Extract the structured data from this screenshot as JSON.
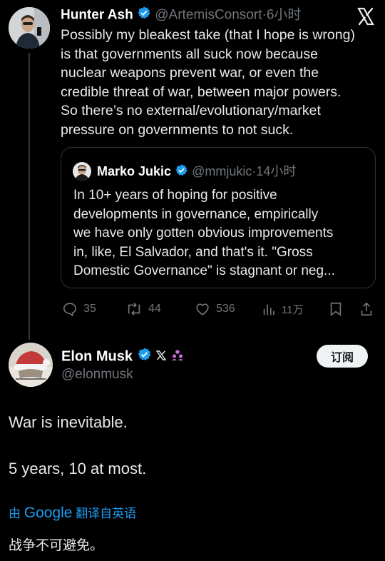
{
  "tweet1": {
    "author_name": "Hunter Ash",
    "author_handle": "@ArtemisConsort",
    "separator": "·",
    "time": "6小时",
    "text_lines": [
      "Possibly my bleakest take (that I hope is wrong)",
      "is that governments all suck now because",
      "nuclear weapons prevent war, or even the",
      "credible threat of war, between major powers.",
      "So there’s no external/evolutionary/market",
      "pressure on governments to not suck."
    ],
    "quote": {
      "author_name": "Marko Jukic",
      "author_handle": "@mmjukic",
      "separator": "·",
      "time": "14小时",
      "text_lines": [
        "In 10+ years of hoping for positive",
        "developments in governance, empirically",
        "we have only gotten obvious improvements",
        "in, like, El Salvador, and that's it. \"Gross",
        "Domestic Governance\" is stagnant or neg..."
      ]
    },
    "actions": {
      "replies": "35",
      "reposts": "44",
      "likes": "536",
      "views": "11万"
    }
  },
  "tweet2": {
    "author_name": "Elon Musk",
    "author_handle": "@elonmusk",
    "subscribe_label": "订阅",
    "text_line1": "War is inevitable.",
    "text_line2": "5 years, 10 at most.",
    "translate_prefix": "由",
    "translate_brand": "Google",
    "translate_suffix": "翻译自英语",
    "translation": "战争不可避免。"
  },
  "colors": {
    "background": "#000000",
    "text": "#e7e9ea",
    "muted": "#71767b",
    "verified": "#1d9bf0",
    "link": "#1d9bf0"
  }
}
